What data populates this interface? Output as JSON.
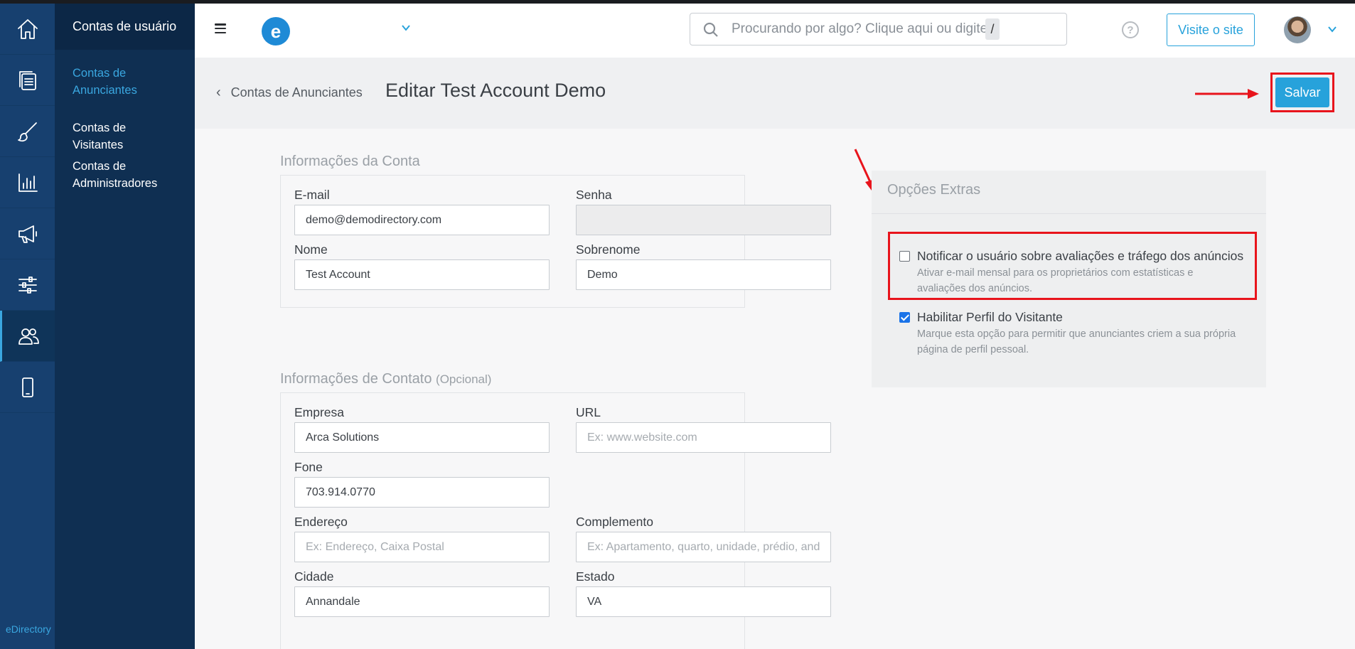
{
  "rail": {
    "items": [
      "home-icon",
      "pages-icon",
      "brush-icon",
      "chart-icon",
      "megaphone-icon",
      "sliders-icon",
      "users-icon",
      "mobile-icon"
    ],
    "brand": "eDirectory"
  },
  "subnav": {
    "title": "Contas de usuário",
    "items": [
      {
        "label": "Contas de Anunciantes",
        "active": true
      },
      {
        "label": "Contas de Visitantes",
        "active": false
      },
      {
        "label": "Contas de Administradores",
        "active": false
      }
    ]
  },
  "header": {
    "logo_letter": "e",
    "search_placeholder": "Procurando por algo? Clique aqui ou digite",
    "search_shortcut": "/",
    "help_label": "?",
    "visit_label": "Visite o site"
  },
  "page": {
    "back_label": "Contas de Anunciantes",
    "title": "Editar Test Account Demo",
    "save_label": "Salvar"
  },
  "account": {
    "section_title": "Informações da Conta",
    "email_label": "E-mail",
    "email_value": "demo@demodirectory.com",
    "password_label": "Senha",
    "password_value": "",
    "first_name_label": "Nome",
    "first_name_value": "Test Account",
    "last_name_label": "Sobrenome",
    "last_name_value": "Demo"
  },
  "contact": {
    "section_title": "Informações de Contato",
    "section_optional": "(Opcional)",
    "company_label": "Empresa",
    "company_value": "Arca Solutions",
    "url_label": "URL",
    "url_placeholder": "Ex: www.website.com",
    "phone_label": "Fone",
    "phone_value": "703.914.0770",
    "address_label": "Endereço",
    "address_placeholder": "Ex: Endereço, Caixa Postal",
    "complement_label": "Complemento",
    "complement_placeholder": "Ex: Apartamento, quarto, unidade, prédio, andar",
    "city_label": "Cidade",
    "city_value": "Annandale",
    "state_label": "Estado",
    "state_value": "VA"
  },
  "extras": {
    "title": "Opções Extras",
    "options": [
      {
        "title": "Notificar o usuário sobre avaliações e tráfego dos anúncios",
        "description": "Ativar e-mail mensal para os proprietários com estatísticas e avaliações dos anúncios.",
        "checked": false
      },
      {
        "title": "Habilitar Perfil do Visitante",
        "description": "Marque esta opção para permitir que anunciantes criem a sua própria página de perfil pessoal.",
        "checked": true
      }
    ]
  },
  "colors": {
    "accent": "#27a2db",
    "highlight": "#e8141c",
    "rail": "#17406f",
    "subnav": "#0f2f52"
  }
}
